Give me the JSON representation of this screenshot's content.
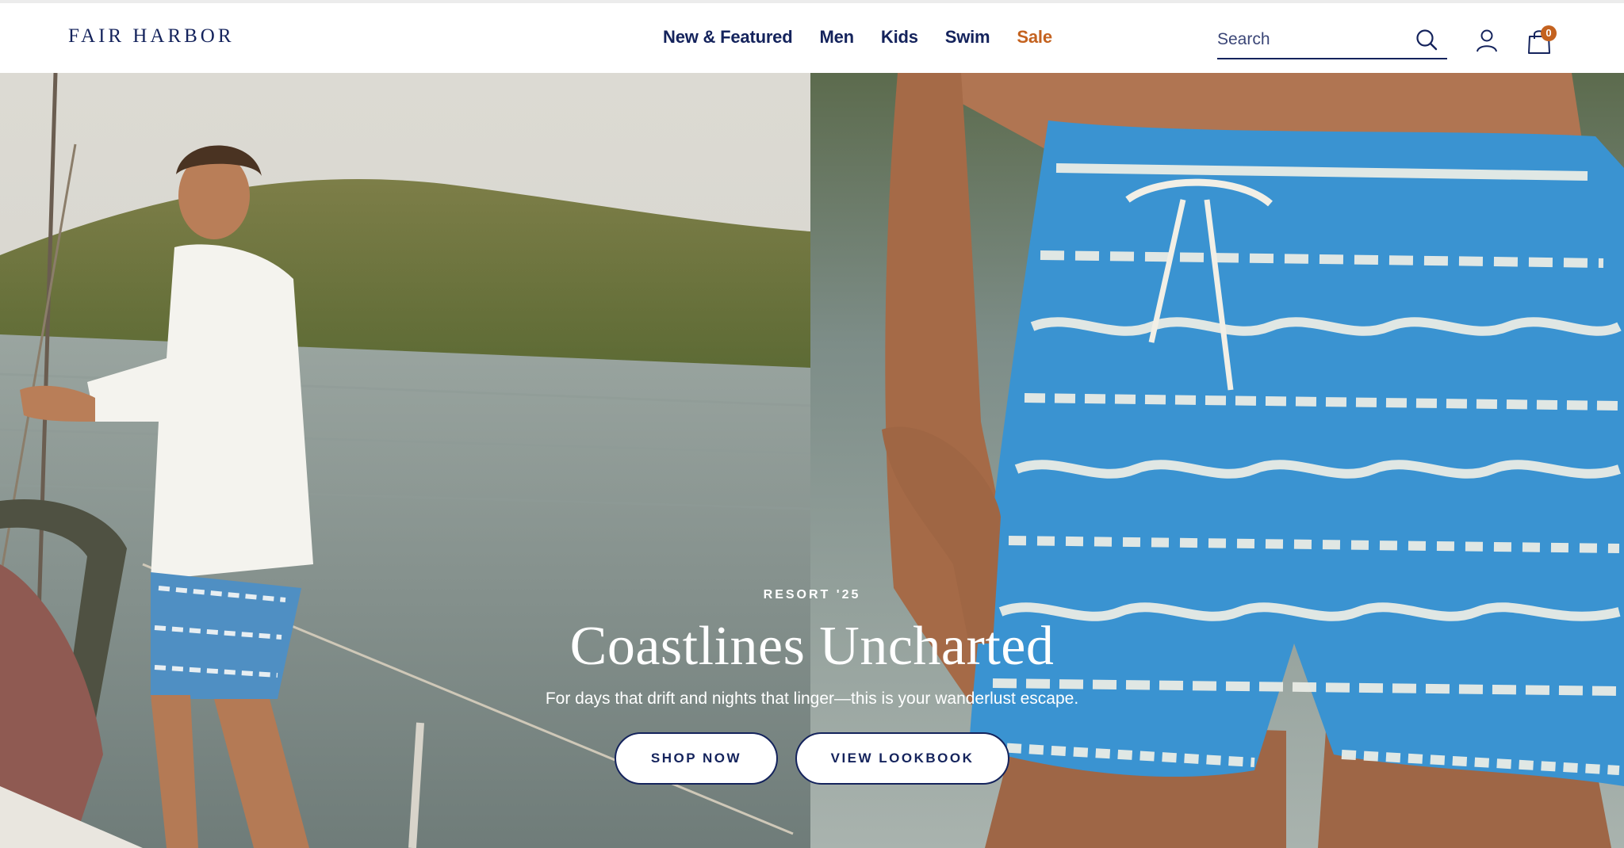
{
  "brand": {
    "logo_text": "FAIR HARBOR"
  },
  "nav": {
    "items": [
      {
        "label": "New & Featured"
      },
      {
        "label": "Men"
      },
      {
        "label": "Kids"
      },
      {
        "label": "Swim"
      },
      {
        "label": "Sale"
      }
    ]
  },
  "search": {
    "placeholder": "Search",
    "value": ""
  },
  "cart": {
    "count": "0"
  },
  "icons": {
    "search": "search-icon",
    "account": "account-icon",
    "cart": "shopping-bag-icon"
  },
  "colors": {
    "brand_navy": "#14235c",
    "sale_orange": "#c4621f",
    "cart_badge": "#c4621f"
  },
  "hero": {
    "eyebrow": "RESORT '25",
    "headline": "Coastlines Uncharted",
    "subhead": "For days that drift and nights that linger—this is your wanderlust escape.",
    "buttons": {
      "shop_now": "SHOP NOW",
      "view_lookbook": "VIEW LOOKBOOK"
    }
  }
}
